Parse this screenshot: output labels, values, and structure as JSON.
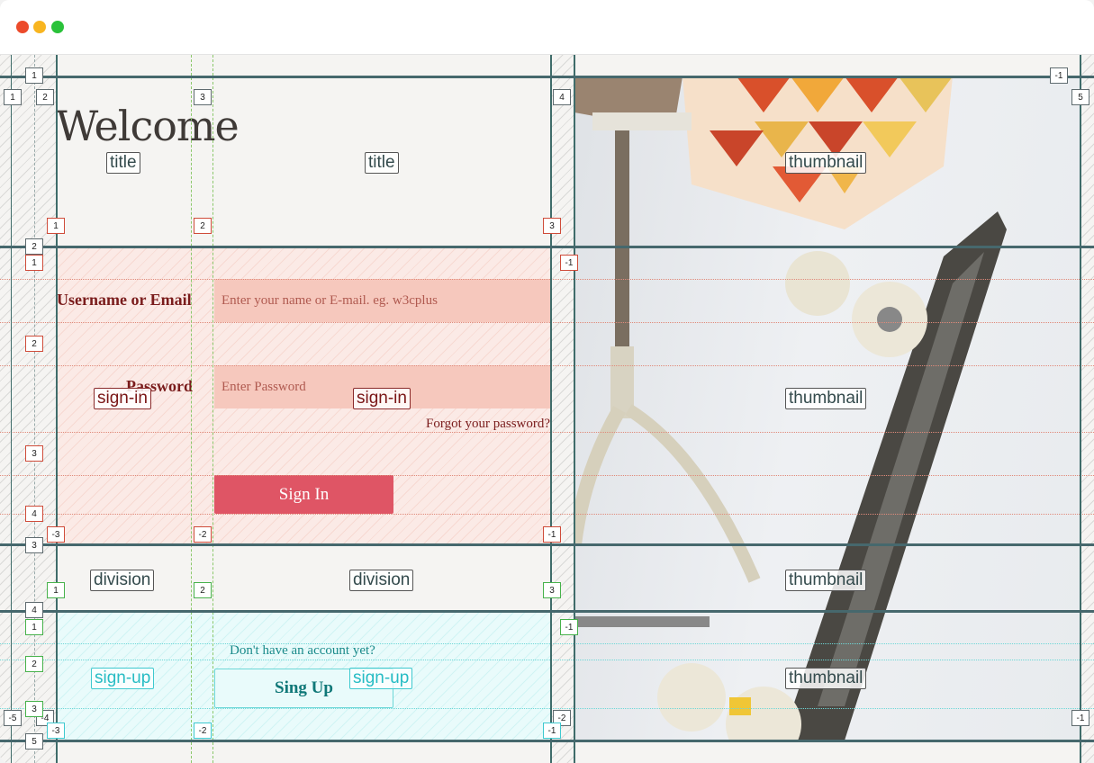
{
  "window": {
    "controls": [
      "close",
      "minimize",
      "maximize"
    ]
  },
  "content": {
    "welcome": "Welcome",
    "username_label": "Username or Email",
    "username_placeholder": "Enter your name or E-mail. eg. w3cplus",
    "password_label": "Password",
    "password_placeholder": "Enter Password",
    "forgot": "Forgot your password?",
    "signin_button": "Sign In",
    "no_account": "Don't have an account yet?",
    "signup_button": "Sing Up"
  },
  "areas": {
    "title": "title",
    "thumbnail": "thumbnail",
    "sign_in": "sign-in",
    "division": "division",
    "sign_up": "sign-up"
  },
  "grid_numbers": {
    "outer_cols": [
      "1",
      "2",
      "3",
      "4",
      "5",
      "-1",
      "-4",
      "-5",
      "-2",
      "-3"
    ],
    "outer_rows": [
      "1",
      "2",
      "3",
      "4",
      "5",
      "-1"
    ],
    "title_cols": [
      "1",
      "2",
      "3"
    ],
    "signin_rows": [
      "1",
      "2",
      "3",
      "4",
      "-1"
    ],
    "signin_cols": [
      "-3",
      "-2",
      "-1"
    ],
    "division_cols": [
      "1",
      "2",
      "3"
    ],
    "signup_rows": [
      "1",
      "2",
      "3",
      "-1"
    ],
    "signup_cols": [
      "-3",
      "-2",
      "-1"
    ]
  },
  "colors": {
    "signin_bg": "#fbeae6",
    "signup_bg": "#e9fbfb",
    "button_red": "#df5565",
    "grid_line": "#3f6c6a"
  }
}
